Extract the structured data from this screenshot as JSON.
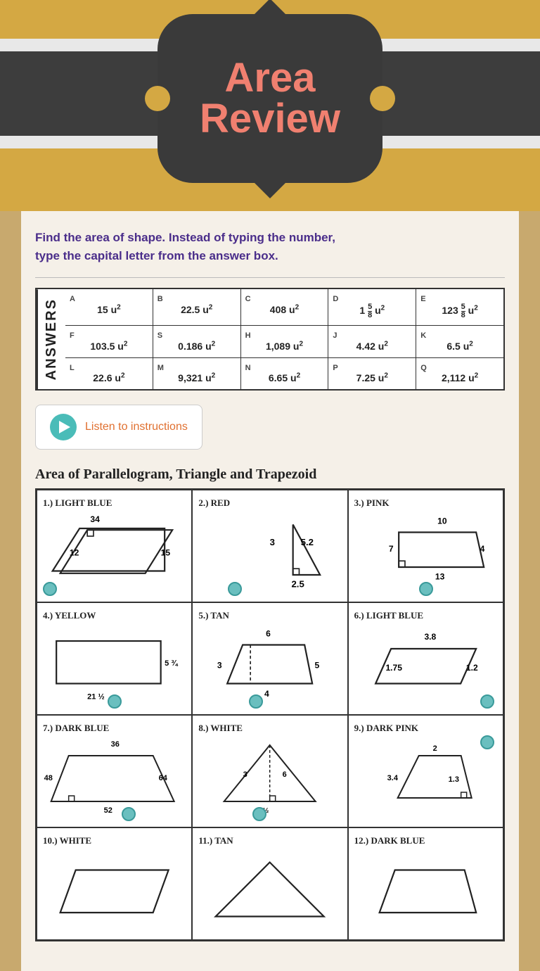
{
  "header": {
    "title": "Area Review"
  },
  "instruction": {
    "line1": "Find the area of shape. Instead of typing the number,",
    "line2": "type the capital letter from the answer box."
  },
  "answers_label": "ANSWERS",
  "answers_rows": [
    [
      {
        "letter": "A",
        "value": "15 u²"
      },
      {
        "letter": "B",
        "value": "22.5 u²"
      },
      {
        "letter": "C",
        "value": "408 u²"
      },
      {
        "letter": "D",
        "value": "1 5/8 u²"
      },
      {
        "letter": "E",
        "value": "123 5/8 u²"
      }
    ],
    [
      {
        "letter": "F",
        "value": "103.5 u²"
      },
      {
        "letter": "S",
        "value": "0.186 u²"
      },
      {
        "letter": "H",
        "value": "1,089 u²"
      },
      {
        "letter": "J",
        "value": "4.42 u²"
      },
      {
        "letter": "K",
        "value": "6.5 u²"
      }
    ],
    [
      {
        "letter": "L",
        "value": "22.6 u²"
      },
      {
        "letter": "M",
        "value": "9,321 u²"
      },
      {
        "letter": "N",
        "value": "6.65 u²"
      },
      {
        "letter": "P",
        "value": "7.25 u²"
      },
      {
        "letter": "Q",
        "value": "2,112 u²"
      }
    ]
  ],
  "listen_button": {
    "label": "Listen to instructions"
  },
  "section_title": "Area of Parallelogram, Triangle and Trapezoid",
  "problems": [
    {
      "number": "1.)",
      "color": "LIGHT BLUE",
      "shape": "parallelogram",
      "dims": [
        "34",
        "12",
        "15"
      ],
      "has_right_angle": true
    },
    {
      "number": "2.)",
      "color": "RED",
      "shape": "triangle",
      "dims": [
        "3",
        "5.2",
        "2.5"
      ],
      "has_right_angle": true
    },
    {
      "number": "3.)",
      "color": "PINK",
      "shape": "trapezoid",
      "dims": [
        "10",
        "7",
        "4",
        "13"
      ],
      "has_right_angle": true
    },
    {
      "number": "4.)",
      "color": "YELLOW",
      "shape": "rectangle",
      "dims": [
        "5 3/4",
        "21 1/2"
      ]
    },
    {
      "number": "5.)",
      "color": "TAN",
      "shape": "trapezoid",
      "dims": [
        "6",
        "3",
        "5",
        "4"
      ]
    },
    {
      "number": "6.)",
      "color": "LIGHT BLUE",
      "shape": "parallelogram",
      "dims": [
        "3.8",
        "1.75",
        "1.2"
      ]
    },
    {
      "number": "7.)",
      "color": "DARK BLUE",
      "shape": "trapezoid",
      "dims": [
        "36",
        "48",
        "64",
        "52"
      ]
    },
    {
      "number": "8.)",
      "color": "WHITE",
      "shape": "triangle",
      "dims": [
        "3",
        "6",
        "7 1/2"
      ]
    },
    {
      "number": "9.)",
      "color": "DARK PINK",
      "shape": "trapezoid",
      "dims": [
        "2",
        "3.4",
        "1.3"
      ]
    },
    {
      "number": "10.)",
      "color": "WHITE",
      "shape": "parallelogram",
      "dims": []
    },
    {
      "number": "11.)",
      "color": "TAN",
      "shape": "triangle",
      "dims": []
    },
    {
      "number": "12.)",
      "color": "DARK BLUE",
      "shape": "trapezoid",
      "dims": []
    }
  ]
}
